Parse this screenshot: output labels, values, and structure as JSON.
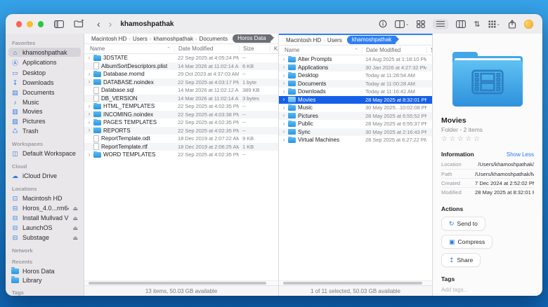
{
  "toolbar": {
    "title": "khamoshpathak",
    "back": "‹",
    "forward": "›",
    "icons": [
      "sidebar-toggle-icon",
      "new-folder-icon",
      "info-icon",
      "split-view-icon",
      "grid-view-icon",
      "list-view-icon",
      "column-view-icon",
      "sort-icon",
      "group-view-icon",
      "share-icon",
      "account-icon"
    ],
    "active_view": "list"
  },
  "icon_glyphs": {
    "home": "⌂",
    "applications": "Ⓐ",
    "desktop": "▭",
    "downloads": "↧",
    "documents": "▤",
    "music": "♪",
    "movies": "▥",
    "pictures": "▨",
    "trash": "♺",
    "workspace": "◫",
    "cloud": "☁",
    "hdd": "⊡",
    "disk": "⊟",
    "eject": "⏏",
    "chevron": "›",
    "sort_caret": "⌃",
    "star": "☆",
    "send": "↻",
    "compress": "▣",
    "share": "↥",
    "sort": "⇅"
  },
  "colors": {
    "selection_blue": "#1560e8",
    "breadcrumb_pill_dark": "#6b6f75",
    "breadcrumb_pill_blue": "#2f7ff2",
    "accent_icon_blue": "#2a7de1",
    "link_blue": "#2478f4"
  },
  "sidebar": {
    "sections": [
      {
        "title": "Favorites",
        "items": [
          {
            "label": "khamoshpathak",
            "icon": "home",
            "selected": true
          },
          {
            "label": "Applications",
            "icon": "applications"
          },
          {
            "label": "Desktop",
            "icon": "desktop"
          },
          {
            "label": "Downloads",
            "icon": "downloads"
          },
          {
            "label": "Documents",
            "icon": "documents"
          },
          {
            "label": "Music",
            "icon": "music"
          },
          {
            "label": "Movies",
            "icon": "movies"
          },
          {
            "label": "Pictures",
            "icon": "pictures"
          },
          {
            "label": "Trash",
            "icon": "trash"
          }
        ]
      },
      {
        "title": "Workspaces",
        "items": [
          {
            "label": "Default Workspace",
            "icon": "workspace"
          }
        ]
      },
      {
        "title": "Cloud",
        "items": [
          {
            "label": "iCloud Drive",
            "icon": "cloud"
          }
        ]
      },
      {
        "title": "Locations",
        "items": [
          {
            "label": "Macintosh HD",
            "icon": "hdd"
          },
          {
            "label": "Horos_4.0...rm64.dmg",
            "icon": "disk",
            "eject": true
          },
          {
            "label": "Install Mullvad VPN",
            "icon": "disk",
            "eject": true
          },
          {
            "label": "LaunchOS",
            "icon": "disk",
            "eject": true
          },
          {
            "label": "Substage",
            "icon": "disk",
            "eject": true
          }
        ]
      },
      {
        "title": "Network",
        "items": []
      },
      {
        "title": "Recents",
        "items": [
          {
            "label": "Horos Data",
            "icon": "folder"
          },
          {
            "label": "Library",
            "icon": "folder"
          }
        ]
      },
      {
        "title": "Tags",
        "items": []
      }
    ]
  },
  "left_pane": {
    "breadcrumbs": [
      {
        "label": "Macintosh HD"
      },
      {
        "label": "Users"
      },
      {
        "label": "khamoshpathak"
      },
      {
        "label": "Documents"
      },
      {
        "label": "Horos Data",
        "pill": "dark"
      }
    ],
    "columns": [
      "Name",
      "Date Modified",
      "Size",
      "Ki"
    ],
    "rows": [
      {
        "name": "3DSTATE",
        "date": "22 Sep 2025 at 4:05:24 PM",
        "size": "--",
        "type": "folder",
        "chev": true
      },
      {
        "name": "AlbumSortDescriptors.plist",
        "date": "14 Mar 2026 at 11:02:14 AM",
        "size": "6 KB",
        "type": "file"
      },
      {
        "name": "Database.momd",
        "date": "29 Oct 2023 at 4:37:03 AM",
        "size": "--",
        "type": "folder",
        "chev": true
      },
      {
        "name": "DATABASE.noindex",
        "date": "22 Sep 2025 at 4:03:17 PM",
        "size": "1 byte",
        "type": "folder",
        "chev": true
      },
      {
        "name": "Database.sql",
        "date": "14 Mar 2026 at 11:02:12 AM",
        "size": "389 KB",
        "type": "file"
      },
      {
        "name": "DB_VERSION",
        "date": "14 Mar 2026 at 11:02:14 AM",
        "size": "3 bytes",
        "type": "file"
      },
      {
        "name": "HTML_TEMPLATES",
        "date": "22 Sep 2025 at 4:02:35 PM",
        "size": "--",
        "type": "folder",
        "chev": true
      },
      {
        "name": "INCOMING.noindex",
        "date": "22 Sep 2025 at 4:03:38 PM",
        "size": "--",
        "type": "folder",
        "chev": true
      },
      {
        "name": "PAGES TEMPLATES",
        "date": "22 Sep 2025 at 4:02:35 PM",
        "size": "--",
        "type": "folder",
        "chev": true
      },
      {
        "name": "REPORTS",
        "date": "22 Sep 2025 at 4:02:35 PM",
        "size": "--",
        "type": "folder",
        "chev": true
      },
      {
        "name": "ReportTemplate.odt",
        "date": "18 Dec 2019 at 2:07:22 AM",
        "size": "9 KB",
        "type": "file"
      },
      {
        "name": "ReportTemplate.rtf",
        "date": "18 Dec 2019 at 2:06:25 AM",
        "size": "1 KB",
        "type": "file"
      },
      {
        "name": "WORD TEMPLATES",
        "date": "22 Sep 2025 at 4:02:35 PM",
        "size": "--",
        "type": "folder",
        "chev": true
      }
    ],
    "status": "13 items, 50.03 GB available"
  },
  "right_pane": {
    "breadcrumbs": [
      {
        "label": "Macintosh HD"
      },
      {
        "label": "Users"
      },
      {
        "label": "khamoshpathak",
        "pill": "blue"
      }
    ],
    "columns": [
      "Name",
      "Date Modified",
      "Si"
    ],
    "rows": [
      {
        "name": "Alter Prompts",
        "date": "14 Aug 2025 at 1:18:10 PM",
        "type": "folder",
        "chev": true
      },
      {
        "name": "Applications",
        "date": "30 Jan 2026 at 4:27:32 PM",
        "type": "folder",
        "chev": true
      },
      {
        "name": "Desktop",
        "date": "Today at 11:28:54 AM",
        "type": "folder",
        "chev": true
      },
      {
        "name": "Documents",
        "date": "Today at 11:00:28 AM",
        "type": "folder",
        "chev": true
      },
      {
        "name": "Downloads",
        "date": "Today at 11:16:42 AM",
        "type": "folder",
        "chev": true
      },
      {
        "name": "Movies",
        "date": "28 May 2025 at 8:32:01 PM",
        "type": "folder",
        "chev": true,
        "selected": true
      },
      {
        "name": "Music",
        "date": "30 May 2025...10:02:08 PM",
        "type": "folder",
        "chev": true
      },
      {
        "name": "Pictures",
        "date": "28 May 2025 at 6:55:52 PM",
        "type": "folder",
        "chev": true
      },
      {
        "name": "Public",
        "date": "28 May 2025 at 6:55:37 PM",
        "type": "folder",
        "chev": true
      },
      {
        "name": "Sync",
        "date": "30 May 2025 at 2:16:43 PM",
        "type": "folder",
        "chev": true
      },
      {
        "name": "Virtual Machines",
        "date": "28 Sep 2025 at 6:27:22 PM",
        "type": "folder",
        "chev": true
      }
    ],
    "status": "1 of 11 selected, 50.03 GB available"
  },
  "preview": {
    "name": "Movies",
    "kind": "Folder - 2 items",
    "rating_stars": 5,
    "info": {
      "heading": "Information",
      "toggle": "Show Less",
      "rows": [
        {
          "label": "Location",
          "value": "/Users/khamoshpathak/"
        },
        {
          "label": "Path",
          "value": "/Users/khamoshpathak/Movies/"
        },
        {
          "label": "Created",
          "value": "7 Dec 2024 at 2:52:02 PM"
        },
        {
          "label": "Modified",
          "value": "28 May 2025 at 8:32:01 PM"
        }
      ]
    },
    "actions": {
      "heading": "Actions",
      "buttons": [
        {
          "label": "Send to",
          "icon": "send"
        },
        {
          "label": "Compress",
          "icon": "compress"
        },
        {
          "label": "Share",
          "icon": "share"
        }
      ]
    },
    "tags": {
      "heading": "Tags",
      "placeholder": "Add tags..."
    }
  }
}
